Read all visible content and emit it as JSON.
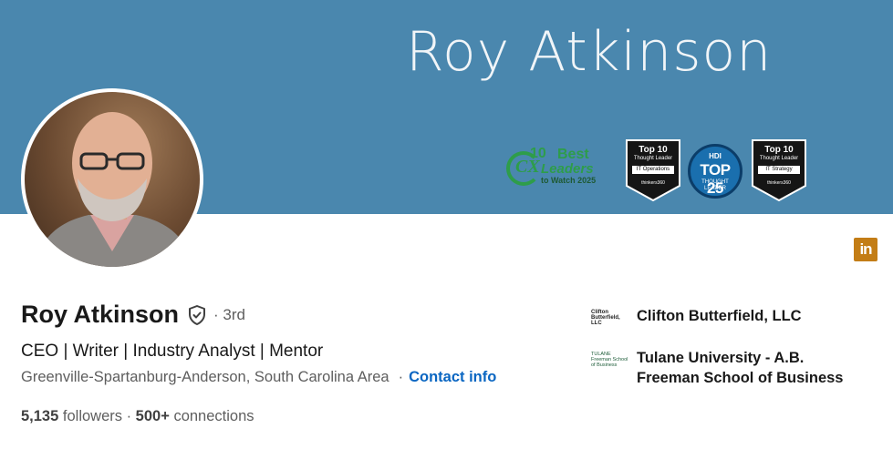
{
  "banner": {
    "name_text": "Roy Atkinson",
    "badge_cx": {
      "number": "10",
      "best": "Best",
      "leaders": "Leaders",
      "cx": "CX",
      "subtitle": "to Watch 2025"
    },
    "badge_itops": {
      "title": "Top 10",
      "subtitle": "Thought Leader",
      "category": "IT Operations",
      "footer": "thinkers360"
    },
    "badge_hdi": {
      "brand": "HDI",
      "title": "TOP 25",
      "subtitle": "THOUGHT LEADER"
    },
    "badge_itstrategy": {
      "title": "Top 10",
      "subtitle": "Thought Leader",
      "category": "IT Strategy",
      "footer": "thinkers360"
    }
  },
  "profile": {
    "name": "Roy Atkinson",
    "degree": "· 3rd",
    "headline": "CEO | Writer | Industry Analyst | Mentor",
    "location": "Greenville-Spartanburg-Anderson, South Carolina Area",
    "separator": "·",
    "contact_label": "Contact info",
    "followers_count": "5,135",
    "followers_label": "followers",
    "stats_sep": " · ",
    "connections_count": "500+",
    "connections_label": "connections"
  },
  "companies": [
    {
      "name": "Clifton Butterfield, LLC",
      "logo_text": "Clifton Butterfield, LLC"
    },
    {
      "name": "Tulane University - A.B. Freeman School of Business",
      "logo_text": "TULANE Freeman School of Business"
    }
  ],
  "icons": {
    "linkedin": "linkedin-icon",
    "verified": "verified-shield-icon"
  },
  "colors": {
    "banner": "#4a87ae",
    "link": "#0a66c2",
    "linkedin": "#c37d16"
  }
}
